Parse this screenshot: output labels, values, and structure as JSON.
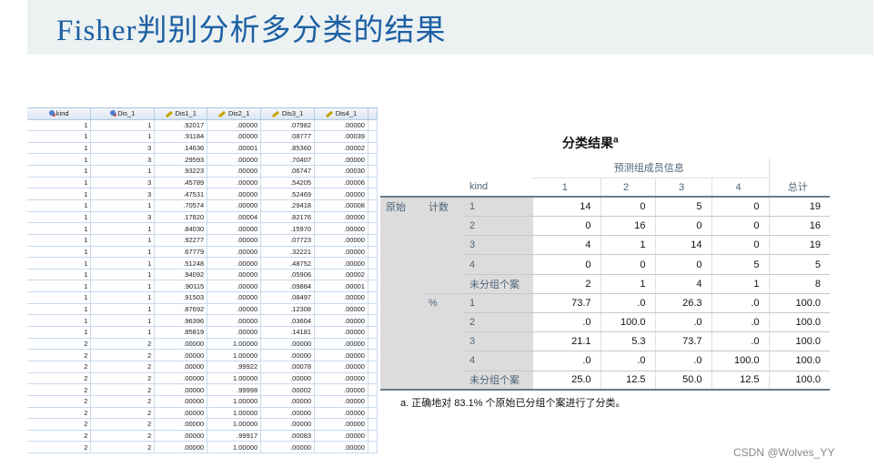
{
  "slide": {
    "title": "Fisher判别分析多分类的结果",
    "watermark": "CSDN @Wolves_YY"
  },
  "grid": {
    "columns": [
      {
        "name": "kind",
        "icon": "nominal-icon"
      },
      {
        "name": "Dis_1",
        "icon": "nominal-icon"
      },
      {
        "name": "Dis1_1",
        "icon": "scale-icon"
      },
      {
        "name": "Dis2_1",
        "icon": "scale-icon"
      },
      {
        "name": "Dis3_1",
        "icon": "scale-icon"
      },
      {
        "name": "Dis4_1",
        "icon": "scale-icon"
      }
    ],
    "rows": [
      [
        "1",
        "1",
        ".92017",
        ".00000",
        ".07982",
        ".00000"
      ],
      [
        "1",
        "1",
        ".91184",
        ".00000",
        ".08777",
        ".00039"
      ],
      [
        "1",
        "3",
        ".14636",
        ".00001",
        ".85360",
        ".00002"
      ],
      [
        "1",
        "3",
        ".29593",
        ".00000",
        ".70407",
        ".00000"
      ],
      [
        "1",
        "1",
        ".93223",
        ".00000",
        ".06747",
        ".00030"
      ],
      [
        "1",
        "3",
        ".45789",
        ".00000",
        ".54205",
        ".00006"
      ],
      [
        "1",
        "3",
        ".47531",
        ".00000",
        ".52469",
        ".00000"
      ],
      [
        "1",
        "1",
        ".70574",
        ".00000",
        ".29418",
        ".00008"
      ],
      [
        "1",
        "3",
        ".17820",
        ".00004",
        ".82176",
        ".00000"
      ],
      [
        "1",
        "1",
        ".84030",
        ".00000",
        ".15970",
        ".00000"
      ],
      [
        "1",
        "1",
        ".92277",
        ".00000",
        ".07723",
        ".00000"
      ],
      [
        "1",
        "1",
        ".67779",
        ".00000",
        ".32221",
        ".00000"
      ],
      [
        "1",
        "1",
        ".51248",
        ".00000",
        ".48752",
        ".00000"
      ],
      [
        "1",
        "1",
        ".94092",
        ".00000",
        ".05906",
        ".00002"
      ],
      [
        "1",
        "1",
        ".90115",
        ".00000",
        ".09884",
        ".00001"
      ],
      [
        "1",
        "1",
        ".91503",
        ".00000",
        ".08497",
        ".00000"
      ],
      [
        "1",
        "1",
        ".87692",
        ".00000",
        ".12308",
        ".00000"
      ],
      [
        "1",
        "1",
        ".96396",
        ".00000",
        ".03604",
        ".00000"
      ],
      [
        "1",
        "1",
        ".85819",
        ".00000",
        ".14181",
        ".00000"
      ],
      [
        "2",
        "2",
        ".00000",
        "1.00000",
        ".00000",
        ".00000"
      ],
      [
        "2",
        "2",
        ".00000",
        "1.00000",
        ".00000",
        ".00000"
      ],
      [
        "2",
        "2",
        ".00000",
        ".99922",
        ".00078",
        ".00000"
      ],
      [
        "2",
        "2",
        ".00000",
        "1.00000",
        ".00000",
        ".00000"
      ],
      [
        "2",
        "2",
        ".00000",
        ".99998",
        ".00002",
        ".00000"
      ],
      [
        "2",
        "2",
        ".00000",
        "1.00000",
        ".00000",
        ".00000"
      ],
      [
        "2",
        "2",
        ".00000",
        "1.00000",
        ".00000",
        ".00000"
      ],
      [
        "2",
        "2",
        ".00000",
        "1.00000",
        ".00000",
        ".00000"
      ],
      [
        "2",
        "2",
        ".00000",
        ".99917",
        ".00083",
        ".00000"
      ],
      [
        "2",
        "2",
        ".00000",
        "1.00000",
        ".00000",
        ".00000"
      ]
    ]
  },
  "result": {
    "title": "分类结果",
    "title_sup": "a",
    "group_header": "预测组成员信息",
    "kind_label": "kind",
    "col_headers": [
      "1",
      "2",
      "3",
      "4"
    ],
    "total_label": "总计",
    "section_label": "原始",
    "blocks": [
      {
        "label": "计数",
        "rows": [
          {
            "label": "1",
            "values": [
              "14",
              "0",
              "5",
              "0",
              "19"
            ]
          },
          {
            "label": "2",
            "values": [
              "0",
              "16",
              "0",
              "0",
              "16"
            ]
          },
          {
            "label": "3",
            "values": [
              "4",
              "1",
              "14",
              "0",
              "19"
            ]
          },
          {
            "label": "4",
            "values": [
              "0",
              "0",
              "0",
              "5",
              "5"
            ]
          },
          {
            "label": "未分组个案",
            "values": [
              "2",
              "1",
              "4",
              "1",
              "8"
            ]
          }
        ]
      },
      {
        "label": "%",
        "rows": [
          {
            "label": "1",
            "values": [
              "73.7",
              ".0",
              "26.3",
              ".0",
              "100.0"
            ]
          },
          {
            "label": "2",
            "values": [
              ".0",
              "100.0",
              ".0",
              ".0",
              "100.0"
            ]
          },
          {
            "label": "3",
            "values": [
              "21.1",
              "5.3",
              "73.7",
              ".0",
              "100.0"
            ]
          },
          {
            "label": "4",
            "values": [
              ".0",
              ".0",
              ".0",
              "100.0",
              "100.0"
            ]
          },
          {
            "label": "未分组个案",
            "values": [
              "25.0",
              "12.5",
              "50.0",
              "12.5",
              "100.0"
            ]
          }
        ]
      }
    ],
    "footnote": "a. 正确地对 83.1% 个原始已分组个案进行了分类。"
  }
}
